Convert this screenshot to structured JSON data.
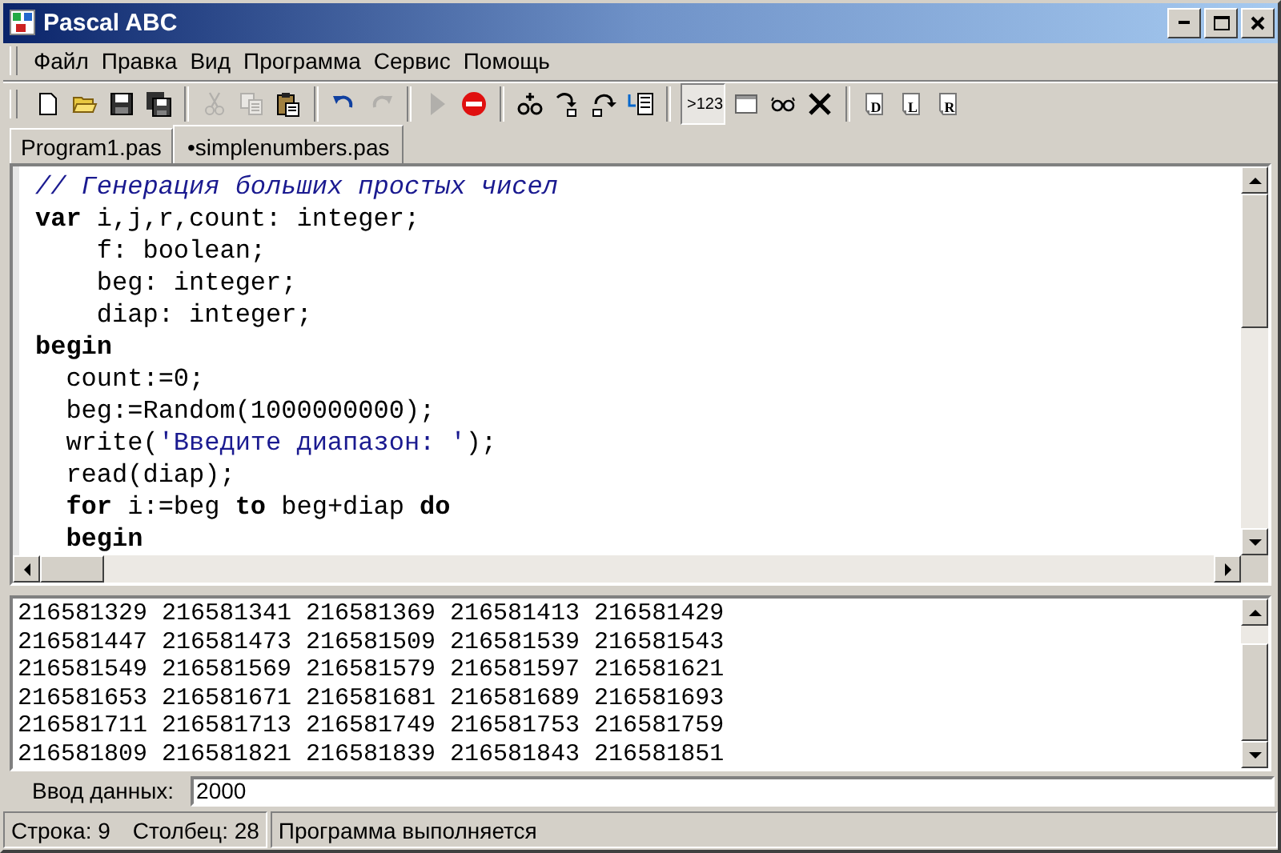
{
  "window": {
    "title": "Pascal ABC"
  },
  "menu": [
    "Файл",
    "Правка",
    "Вид",
    "Программа",
    "Сервис",
    "Помощь"
  ],
  "toolbar": [
    {
      "kind": "new",
      "disabled": false
    },
    {
      "kind": "open",
      "disabled": false
    },
    {
      "kind": "save",
      "disabled": false
    },
    {
      "kind": "save-all",
      "disabled": false
    },
    {
      "kind": "separator"
    },
    {
      "kind": "cut",
      "disabled": true
    },
    {
      "kind": "copy",
      "disabled": true
    },
    {
      "kind": "paste",
      "disabled": false
    },
    {
      "kind": "separator"
    },
    {
      "kind": "undo",
      "disabled": false
    },
    {
      "kind": "redo",
      "disabled": true
    },
    {
      "kind": "separator"
    },
    {
      "kind": "run",
      "disabled": true
    },
    {
      "kind": "stop",
      "disabled": false
    },
    {
      "kind": "separator"
    },
    {
      "kind": "watch",
      "disabled": false
    },
    {
      "kind": "step-into",
      "disabled": false
    },
    {
      "kind": "step-over",
      "disabled": false
    },
    {
      "kind": "list",
      "disabled": false
    },
    {
      "kind": "separator"
    },
    {
      "kind": "text",
      "label": ">123",
      "pressed": true
    },
    {
      "kind": "window",
      "disabled": false
    },
    {
      "kind": "glasses",
      "disabled": false
    },
    {
      "kind": "cross",
      "disabled": false
    },
    {
      "kind": "separator"
    },
    {
      "kind": "page",
      "label": "D",
      "disabled": false
    },
    {
      "kind": "page",
      "label": "L",
      "disabled": false
    },
    {
      "kind": "page",
      "label": "R",
      "disabled": false
    }
  ],
  "tabs": [
    {
      "label": "Program1.pas",
      "selected": false
    },
    {
      "label": "•simplenumbers.pas",
      "selected": true
    }
  ],
  "editor": {
    "lines": [
      [
        {
          "kind": "comment",
          "text": "// Генерация больших простых чисел"
        }
      ],
      [
        {
          "kind": "keyword",
          "text": "var"
        },
        {
          "kind": "plain",
          "text": " i,j,r,count: integer;"
        }
      ],
      [
        {
          "kind": "plain",
          "text": "    f: boolean;"
        }
      ],
      [
        {
          "kind": "plain",
          "text": "    beg: integer;"
        }
      ],
      [
        {
          "kind": "plain",
          "text": "    diap: integer;"
        }
      ],
      [
        {
          "kind": "keyword",
          "text": "begin"
        }
      ],
      [
        {
          "kind": "plain",
          "text": "  count:=0;"
        }
      ],
      [
        {
          "kind": "plain",
          "text": "  beg:=Random(1000000000);"
        }
      ],
      [
        {
          "kind": "plain",
          "text": "  write("
        },
        {
          "kind": "string",
          "text": "'Введите диапазон: '"
        },
        {
          "kind": "plain",
          "text": ");"
        }
      ],
      [
        {
          "kind": "plain",
          "text": "  read(diap);"
        }
      ],
      [
        {
          "kind": "keyword",
          "text": "  for"
        },
        {
          "kind": "plain",
          "text": " i:=beg "
        },
        {
          "kind": "keyword",
          "text": "to"
        },
        {
          "kind": "plain",
          "text": " beg+diap "
        },
        {
          "kind": "keyword",
          "text": "do"
        }
      ],
      [
        {
          "kind": "keyword",
          "text": "  begin"
        }
      ]
    ]
  },
  "output": {
    "lines": [
      "216581329 216581341 216581369 216581413 216581429",
      "216581447 216581473 216581509 216581539 216581543",
      "216581549 216581569 216581579 216581597 216581621",
      "216581653 216581671 216581681 216581689 216581693",
      "216581711 216581713 216581749 216581753 216581759",
      "216581809 216581821 216581839 216581843 216581851"
    ]
  },
  "input": {
    "label": "Ввод данных:",
    "value": "2000"
  },
  "status_bar": {
    "position": [
      "Строка: 9",
      "Столбец: 28"
    ],
    "message": "Программа выполняется"
  }
}
